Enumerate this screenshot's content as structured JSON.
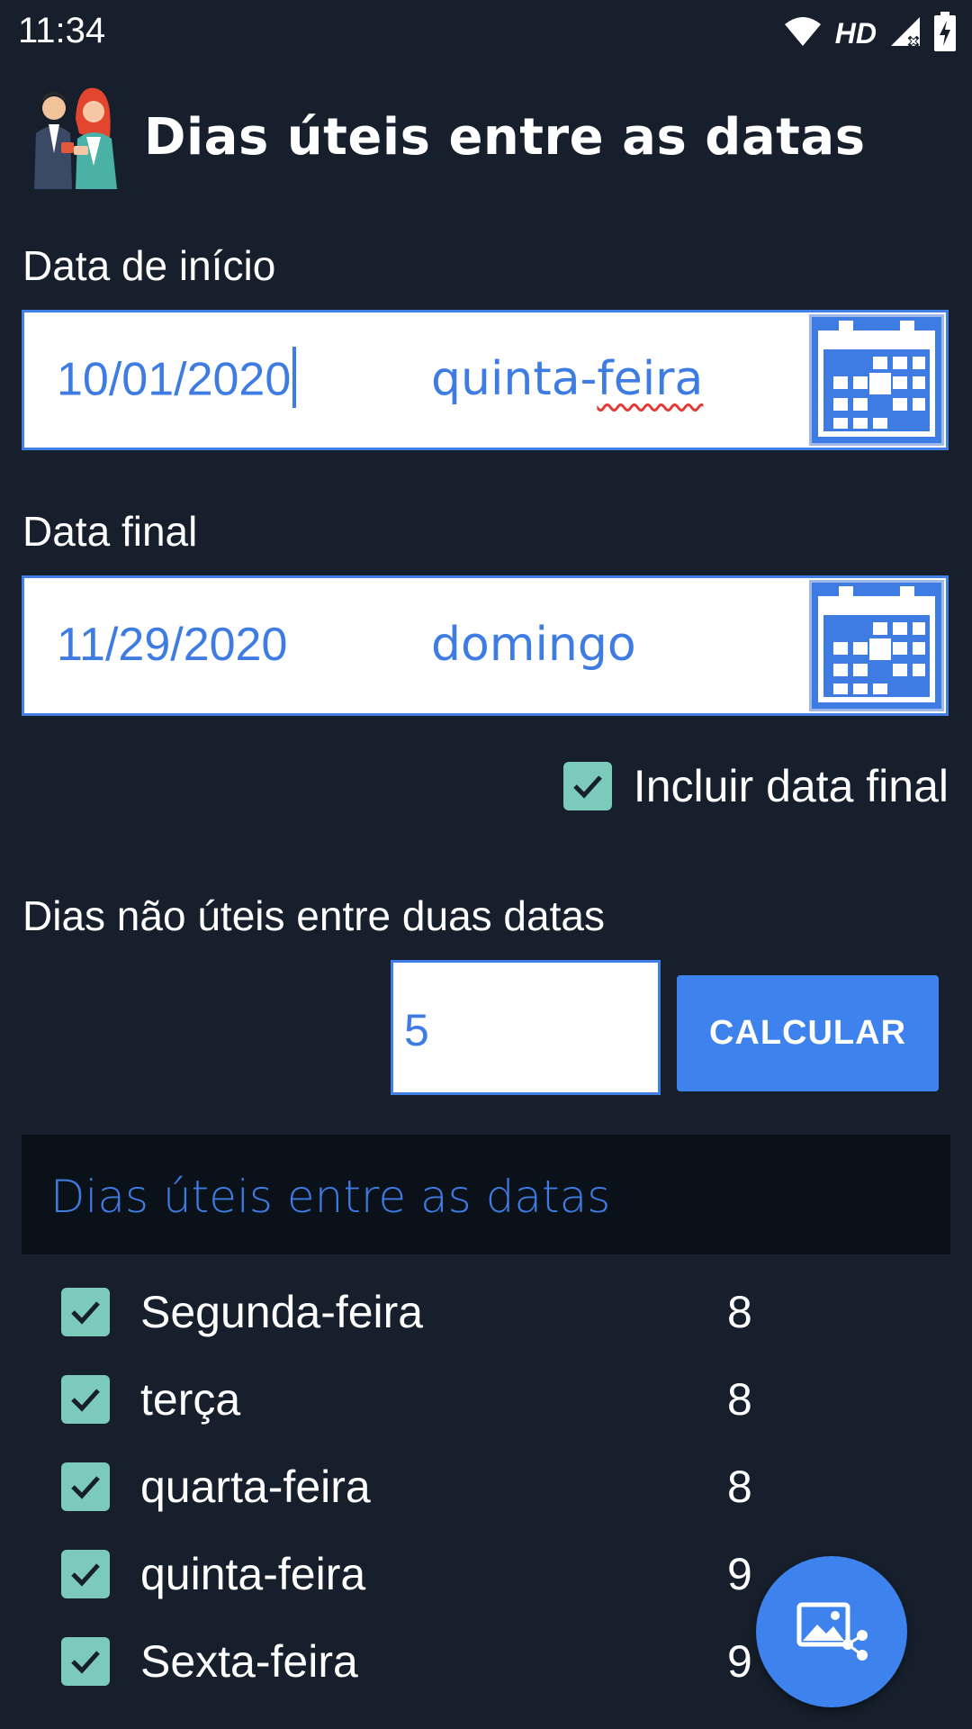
{
  "status_bar": {
    "time": "11:34",
    "network_label": "HD",
    "icons": [
      "wifi-icon",
      "signal-icon",
      "battery-charging-icon"
    ]
  },
  "header": {
    "title": "Dias úteis entre as datas",
    "logo_icon": "people-logo-icon"
  },
  "start_date": {
    "label": "Data de início",
    "value": "10/01/2020",
    "weekday_part1": "quinta-",
    "weekday_part2": "feira",
    "calendar_icon": "calendar-icon"
  },
  "end_date": {
    "label": "Data final",
    "value": "11/29/2020",
    "weekday": "domingo",
    "calendar_icon": "calendar-icon"
  },
  "include_end": {
    "label": "Incluir data final",
    "checked": true
  },
  "non_working": {
    "label": "Dias não úteis entre duas datas",
    "value": "5",
    "button_label": "CALCULAR"
  },
  "results": {
    "title": "Dias úteis entre as datas",
    "days": [
      {
        "name": "Segunda-feira",
        "count": "8",
        "checked": true
      },
      {
        "name": "terça",
        "count": "8",
        "checked": true
      },
      {
        "name": "quarta-feira",
        "count": "8",
        "checked": true
      },
      {
        "name": "quinta-feira",
        "count": "9",
        "checked": true
      },
      {
        "name": "Sexta-feira",
        "count": "9",
        "checked": true
      }
    ]
  },
  "fab": {
    "icon": "share-image-icon"
  },
  "colors": {
    "background": "#161f2b",
    "accent": "#3e82ee",
    "checkbox": "#7ccabc",
    "results_header_bg": "#0b1118"
  }
}
